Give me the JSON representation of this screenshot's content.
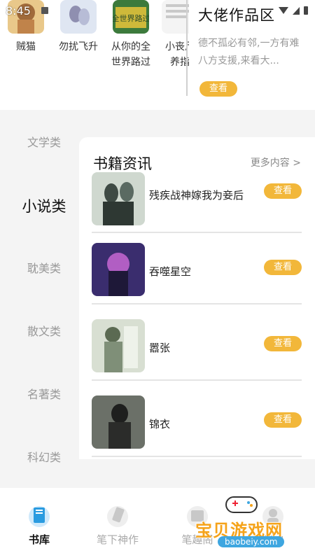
{
  "status_bar": {
    "time": "8:45"
  },
  "top_books": [
    {
      "title_lines": [
        "贼猫"
      ],
      "cover_colors": [
        "#e9c88a",
        "#a06a3a"
      ]
    },
    {
      "title_lines": [
        "勿扰飞升"
      ],
      "cover_colors": [
        "#dfe6f2",
        "#8f8fb0"
      ]
    },
    {
      "title_lines": [
        "从你的全",
        "世界路过"
      ],
      "cover_colors": [
        "#3c7a3c",
        "#e8c43a"
      ],
      "cover_text": "全世界路过"
    },
    {
      "title_lines": [
        "小丧尸",
        "养指"
      ],
      "cover_colors": [
        "#f4f4f4",
        "#c9c9c9"
      ]
    }
  ],
  "promo": {
    "title": "大佬作品区",
    "description": "德不孤必有邻,一方有难八方支援,来看大...",
    "button_label": "查看"
  },
  "categories": [
    {
      "label": "文学类",
      "active": false
    },
    {
      "label": "小说类",
      "active": true
    },
    {
      "label": "耽美类",
      "active": false
    },
    {
      "label": "散文类",
      "active": false
    },
    {
      "label": "名著类",
      "active": false
    },
    {
      "label": "科幻类",
      "active": false
    }
  ],
  "section": {
    "title": "书籍资讯",
    "more_label": "更多内容 >"
  },
  "news": [
    {
      "title": "残疾战神嫁我为妾后",
      "button": "查看",
      "thumb_colors": [
        "#cfd8cf",
        "#3e4a44"
      ]
    },
    {
      "title": "吞噬星空",
      "button": "查看",
      "thumb_colors": [
        "#3a2d6e",
        "#d06ad8"
      ]
    },
    {
      "title": "嚣张",
      "button": "查看",
      "thumb_colors": [
        "#d8dfd2",
        "#5b6a52"
      ]
    },
    {
      "title": "锦衣",
      "button": "查看",
      "thumb_colors": [
        "#6b7068",
        "#1e1f1e"
      ]
    }
  ],
  "bottom_nav": [
    {
      "label": "书库",
      "icon": "book-icon",
      "active": true
    },
    {
      "label": "笔下神作",
      "icon": "pen-icon",
      "active": false
    },
    {
      "label": "笔趣阁",
      "icon": "box-icon",
      "active": false
    },
    {
      "label": "我的",
      "icon": "user-icon",
      "active": false
    }
  ],
  "watermark": {
    "text": "宝贝游戏网",
    "sub": "baobeiy.com"
  },
  "colors": {
    "accent": "#f2b73a",
    "background": "#f4f4f4"
  }
}
